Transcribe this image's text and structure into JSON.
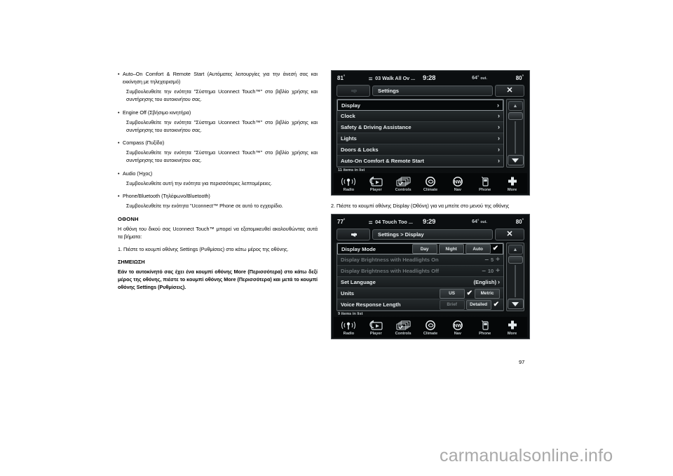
{
  "left_column": {
    "bullets": [
      {
        "title": "Auto–On Comfort & Remote Start (Αυτόματες λειτουργίες για την άνεσή σας και εκκίνηση με τηλεχειρισμό)",
        "body": "Συμβουλευθείτε την ενότητα \"Σύστημα Uconnect Touch™\" στο βιβλίο χρήσης και συντήρησης του αυτοκινήτου σας."
      },
      {
        "title": "Engine Off (Σβήσιμο κινητήρα)",
        "body": "Συμβουλευθείτε την ενότητα \"Σύστημα Uconnect Touch™\" στο βιβλίο χρήσης και συντήρησης του αυτοκινήτου σας."
      },
      {
        "title": "Compass (Πυξίδα)",
        "body": "Συμβουλευθείτε την ενότητα \"Σύστημα Uconnect Touch™\" στο βιβλίο χρήσης και συντήρησης του αυτοκινήτου σας."
      },
      {
        "title": "Audio (Ήχος)",
        "body": "Συμβουλευθείτε αυτή την ενότητα για περισσότερες λεπτομέρειες."
      },
      {
        "title": "Phone/Bluetooth (Τηλέφωνο/Bluetooth)",
        "body": "Συμβουλευθείτε την ενότητα \"Uconnect™ Phone σε αυτό το εγχειρίδιο."
      }
    ],
    "section_heading": "ΟΘΟΝΗ",
    "section_body": "Η οθόνη του δικού σας Uconnect Touch™ μπορεί να εξατομικευθεί ακολουθώντας αυτά τα βήματα:",
    "step_1": "1. Πιέστε το κουμπί οθόνης Settings (Ρυθμίσεις) στο κάτω μέρος της οθόνης.",
    "note_heading": "ΣΗΜΕΙΩΣΗ",
    "note_body": "Εάν το αυτοκίνητό σας έχει ένα κουμπί οθόνης More (Περισσότερα) στο κάτω δεξί μέρος της οθόνης, πιέστε το κουμπί οθόνης More (Περισσότερα) και μετά το κουμπί οθόνης Settings (Ρυθμίσεις)."
  },
  "right_column": {
    "step_2": "2. Πιέστε το κουμπί οθόνης Display (Οθόνη) για να μπείτε στο μενού της οθόνης"
  },
  "screen_1": {
    "status": {
      "temp_left": "81",
      "deg": "°",
      "usb_icon": "usb-icon",
      "track": "03 Walk All Ov ...",
      "clock": "9:28",
      "outside_temp": "64",
      "outside_label": "out.",
      "temp_right": "80"
    },
    "titlebar": {
      "back_icon": "back-arrow-icon",
      "back_enabled": false,
      "title": "Settings",
      "close_icon": "close-icon",
      "close_label": "✕"
    },
    "rows": [
      {
        "label": "Display",
        "chev": "›",
        "highlighted": true
      },
      {
        "label": "Clock",
        "chev": "›",
        "highlighted": false
      },
      {
        "label": "Safety & Driving Assistance",
        "chev": "›",
        "highlighted": false
      },
      {
        "label": "Lights",
        "chev": "›",
        "highlighted": false
      },
      {
        "label": "Doors & Locks",
        "chev": "›",
        "highlighted": false
      },
      {
        "label": "Auto-On Comfort & Remote Start",
        "chev": "›",
        "highlighted": false
      }
    ],
    "items_count": "11 items in list"
  },
  "screen_2": {
    "status": {
      "temp_left": "77",
      "deg": "°",
      "usb_icon": "usb-icon",
      "track": "04 Touch Too ...",
      "clock": "9:29",
      "outside_temp": "64",
      "outside_label": "out.",
      "temp_right": "80"
    },
    "titlebar": {
      "back_icon": "back-arrow-icon",
      "back_enabled": true,
      "title": "Settings > Display",
      "close_icon": "close-icon",
      "close_label": "✕"
    },
    "rows": [
      {
        "label": "Display Mode",
        "highlighted": true,
        "type": "options",
        "options": [
          {
            "text": "Day",
            "selected": false
          },
          {
            "text": "Night",
            "selected": false
          },
          {
            "text": "Auto",
            "selected": true
          }
        ],
        "check": "✔"
      },
      {
        "label": "Display Brightness with Headlights On",
        "dim": true,
        "type": "stepper",
        "minus": "–",
        "value": "5",
        "plus": "+"
      },
      {
        "label": "Display Brightness with Headlights Off",
        "dim": true,
        "type": "stepper",
        "minus": "–",
        "value": "10",
        "plus": "+"
      },
      {
        "label": "Set Language",
        "type": "value-chev",
        "value": "(English)",
        "chev": "›"
      },
      {
        "label": "Units",
        "type": "options",
        "options": [
          {
            "text": "US",
            "selected": true
          },
          {
            "text": "Metric",
            "selected": false
          }
        ],
        "check": "✔"
      },
      {
        "label": "Voice Response Length",
        "type": "options",
        "options": [
          {
            "text": "Brief",
            "selected": false
          },
          {
            "text": "Detailed",
            "selected": true
          }
        ],
        "check": "✔"
      }
    ],
    "items_count": "9 items in list"
  },
  "toolbar": {
    "items": [
      {
        "label": "Radio",
        "icon": "radio-antenna-icon"
      },
      {
        "label": "Player",
        "icon": "media-player-icon"
      },
      {
        "label": "Controls",
        "icon": "controls-cards-icon"
      },
      {
        "label": "Climate",
        "icon": "climate-fan-icon"
      },
      {
        "label": "Nav",
        "icon": "nav-compass-icon"
      },
      {
        "label": "Phone",
        "icon": "phone-icon"
      },
      {
        "label": "More",
        "icon": "more-plus-icon"
      }
    ]
  },
  "page": {
    "number": "97",
    "watermark": "carmanualsonline.info"
  },
  "colors": {
    "screen_bg": "#0d1012",
    "row_text": "#e8edef",
    "highlight_border": "#8b9296",
    "dim_text": "#6f7679",
    "watermark": "#a9a9a9"
  }
}
